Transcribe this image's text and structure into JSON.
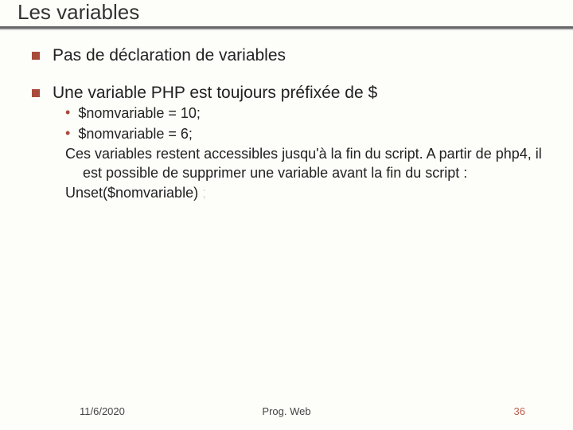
{
  "title": "Les variables",
  "bullets": {
    "b1": "Pas de déclaration de variables",
    "b2": "Une variable PHP est toujours préfixée de $",
    "sub1": "$nomvariable = 10;",
    "sub2": "$nomvariable = 6;",
    "para": "Ces variables restent accessibles jusqu'à la fin du script. A partir de php4, il est possible de supprimer une variable avant la fin du script :",
    "unset": "Unset($nomvariable)",
    "semicolon": " ;"
  },
  "footer": {
    "date": "11/6/2020",
    "center": "Prog. Web",
    "page": "36"
  }
}
